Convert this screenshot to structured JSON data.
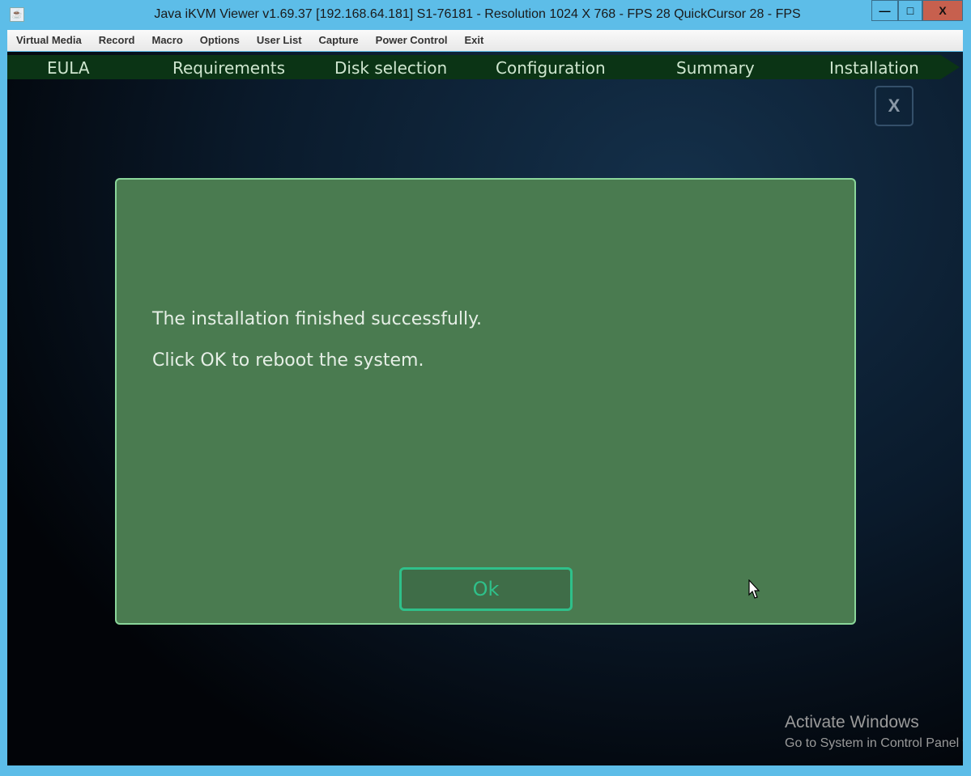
{
  "window": {
    "title": "Java iKVM Viewer v1.69.37 [192.168.64.181] S1-76181 - Resolution 1024 X 768 - FPS 28 QuickCursor 28 - FPS",
    "minimize": "—",
    "maximize": "□",
    "close": "X"
  },
  "menu": [
    "Virtual Media",
    "Record",
    "Macro",
    "Options",
    "User List",
    "Capture",
    "Power Control",
    "Exit"
  ],
  "steps": [
    "EULA",
    "Requirements",
    "Disk selection",
    "Configuration",
    "Summary",
    "Installation"
  ],
  "close_label": "X",
  "dialog": {
    "line1": "The installation finished successfully.",
    "line2": "Click OK to reboot the system.",
    "ok": "Ok"
  },
  "watermark": {
    "title": "Activate Windows",
    "subtitle": "Go to System in Control Panel to activate Windows."
  }
}
